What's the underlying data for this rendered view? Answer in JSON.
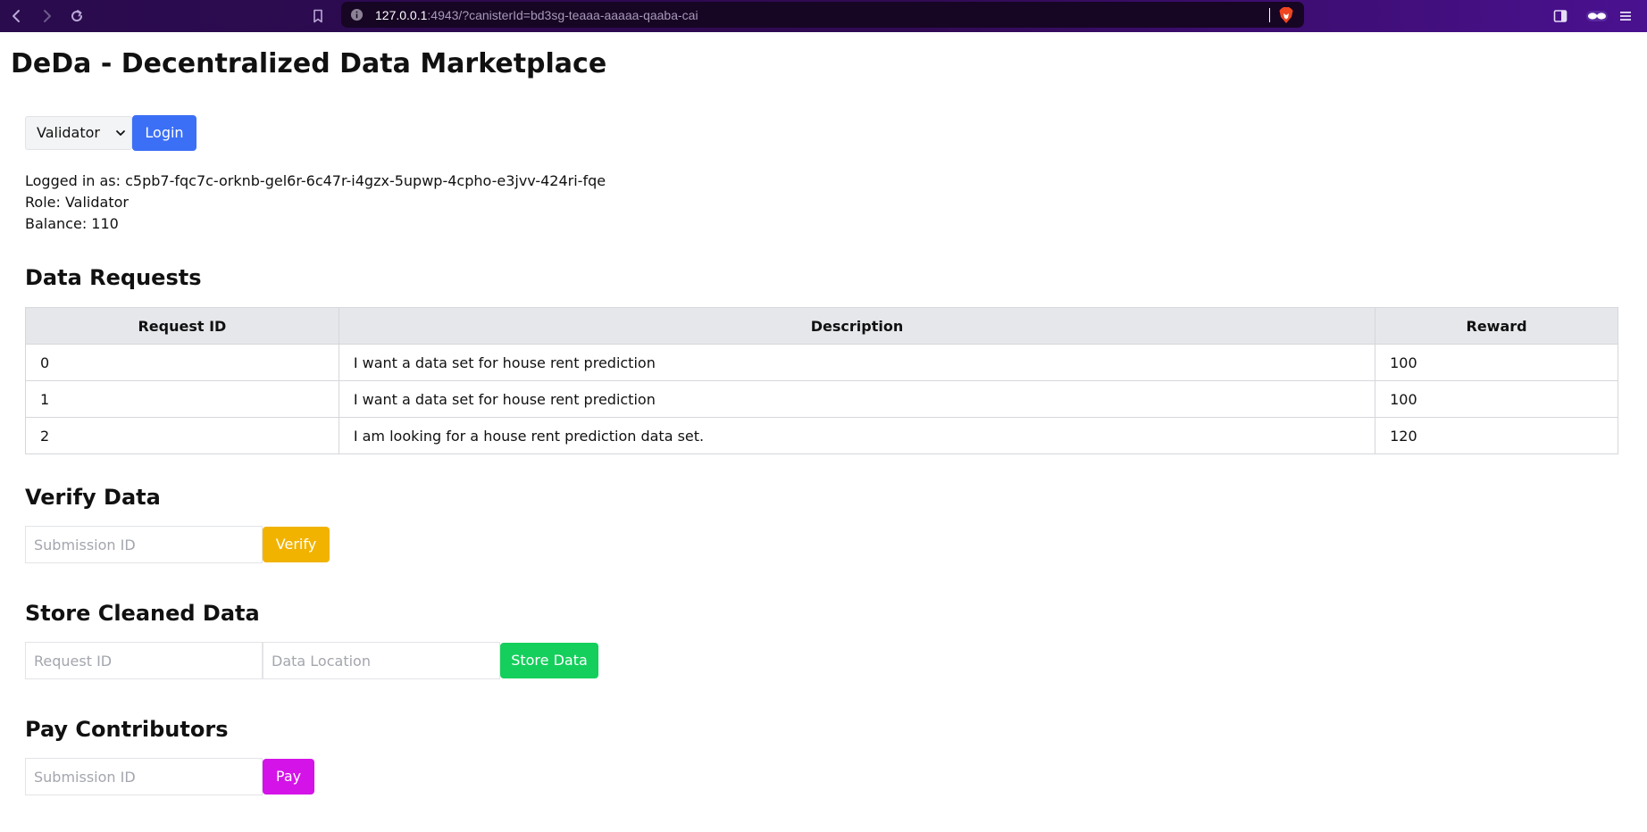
{
  "browser": {
    "url_host": "127.0.0.1",
    "url_rest": ":4943/?canisterId=bd3sg-teaaa-aaaaa-qaaba-cai"
  },
  "page": {
    "title": "DeDa - Decentralized Data Marketplace"
  },
  "login": {
    "role_selected": "Validator",
    "login_label": "Login"
  },
  "account": {
    "logged_in_as": "Logged in as: c5pb7-fqc7c-orknb-gel6r-6c47r-i4gzx-5upwp-4cpho-e3jvv-424ri-fqe",
    "role": "Role: Validator",
    "balance": "Balance: 110"
  },
  "requests": {
    "title": "Data Requests",
    "headers": [
      "Request ID",
      "Description",
      "Reward"
    ],
    "rows": [
      [
        "0",
        "I want a data set for house rent prediction",
        "100"
      ],
      [
        "1",
        "I want a data set for house rent prediction",
        "100"
      ],
      [
        "2",
        "I am looking for a house rent prediction data set.",
        "120"
      ]
    ]
  },
  "verify": {
    "title": "Verify Data",
    "submission_placeholder": "Submission ID",
    "button_label": "Verify"
  },
  "store": {
    "title": "Store Cleaned Data",
    "request_placeholder": "Request ID",
    "location_placeholder": "Data Location",
    "button_label": "Store Data"
  },
  "pay": {
    "title": "Pay Contributors",
    "submission_placeholder": "Submission ID",
    "button_label": "Pay"
  },
  "colors": {
    "login": "#3b6ff6",
    "verify": "#f1b300",
    "store": "#14cf5c",
    "pay": "#d413e8"
  }
}
